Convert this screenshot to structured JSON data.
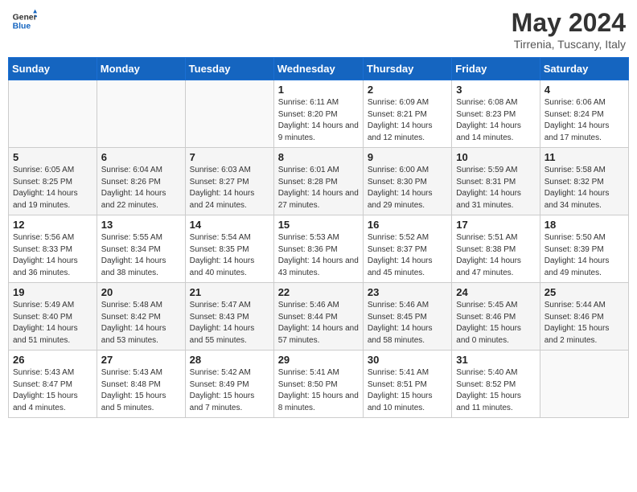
{
  "header": {
    "logo_line1": "General",
    "logo_line2": "Blue",
    "month": "May 2024",
    "location": "Tirrenia, Tuscany, Italy"
  },
  "columns": [
    "Sunday",
    "Monday",
    "Tuesday",
    "Wednesday",
    "Thursday",
    "Friday",
    "Saturday"
  ],
  "weeks": [
    [
      {
        "day": "",
        "info": ""
      },
      {
        "day": "",
        "info": ""
      },
      {
        "day": "",
        "info": ""
      },
      {
        "day": "1",
        "info": "Sunrise: 6:11 AM\nSunset: 8:20 PM\nDaylight: 14 hours and 9 minutes."
      },
      {
        "day": "2",
        "info": "Sunrise: 6:09 AM\nSunset: 8:21 PM\nDaylight: 14 hours and 12 minutes."
      },
      {
        "day": "3",
        "info": "Sunrise: 6:08 AM\nSunset: 8:23 PM\nDaylight: 14 hours and 14 minutes."
      },
      {
        "day": "4",
        "info": "Sunrise: 6:06 AM\nSunset: 8:24 PM\nDaylight: 14 hours and 17 minutes."
      }
    ],
    [
      {
        "day": "5",
        "info": "Sunrise: 6:05 AM\nSunset: 8:25 PM\nDaylight: 14 hours and 19 minutes."
      },
      {
        "day": "6",
        "info": "Sunrise: 6:04 AM\nSunset: 8:26 PM\nDaylight: 14 hours and 22 minutes."
      },
      {
        "day": "7",
        "info": "Sunrise: 6:03 AM\nSunset: 8:27 PM\nDaylight: 14 hours and 24 minutes."
      },
      {
        "day": "8",
        "info": "Sunrise: 6:01 AM\nSunset: 8:28 PM\nDaylight: 14 hours and 27 minutes."
      },
      {
        "day": "9",
        "info": "Sunrise: 6:00 AM\nSunset: 8:30 PM\nDaylight: 14 hours and 29 minutes."
      },
      {
        "day": "10",
        "info": "Sunrise: 5:59 AM\nSunset: 8:31 PM\nDaylight: 14 hours and 31 minutes."
      },
      {
        "day": "11",
        "info": "Sunrise: 5:58 AM\nSunset: 8:32 PM\nDaylight: 14 hours and 34 minutes."
      }
    ],
    [
      {
        "day": "12",
        "info": "Sunrise: 5:56 AM\nSunset: 8:33 PM\nDaylight: 14 hours and 36 minutes."
      },
      {
        "day": "13",
        "info": "Sunrise: 5:55 AM\nSunset: 8:34 PM\nDaylight: 14 hours and 38 minutes."
      },
      {
        "day": "14",
        "info": "Sunrise: 5:54 AM\nSunset: 8:35 PM\nDaylight: 14 hours and 40 minutes."
      },
      {
        "day": "15",
        "info": "Sunrise: 5:53 AM\nSunset: 8:36 PM\nDaylight: 14 hours and 43 minutes."
      },
      {
        "day": "16",
        "info": "Sunrise: 5:52 AM\nSunset: 8:37 PM\nDaylight: 14 hours and 45 minutes."
      },
      {
        "day": "17",
        "info": "Sunrise: 5:51 AM\nSunset: 8:38 PM\nDaylight: 14 hours and 47 minutes."
      },
      {
        "day": "18",
        "info": "Sunrise: 5:50 AM\nSunset: 8:39 PM\nDaylight: 14 hours and 49 minutes."
      }
    ],
    [
      {
        "day": "19",
        "info": "Sunrise: 5:49 AM\nSunset: 8:40 PM\nDaylight: 14 hours and 51 minutes."
      },
      {
        "day": "20",
        "info": "Sunrise: 5:48 AM\nSunset: 8:42 PM\nDaylight: 14 hours and 53 minutes."
      },
      {
        "day": "21",
        "info": "Sunrise: 5:47 AM\nSunset: 8:43 PM\nDaylight: 14 hours and 55 minutes."
      },
      {
        "day": "22",
        "info": "Sunrise: 5:46 AM\nSunset: 8:44 PM\nDaylight: 14 hours and 57 minutes."
      },
      {
        "day": "23",
        "info": "Sunrise: 5:46 AM\nSunset: 8:45 PM\nDaylight: 14 hours and 58 minutes."
      },
      {
        "day": "24",
        "info": "Sunrise: 5:45 AM\nSunset: 8:46 PM\nDaylight: 15 hours and 0 minutes."
      },
      {
        "day": "25",
        "info": "Sunrise: 5:44 AM\nSunset: 8:46 PM\nDaylight: 15 hours and 2 minutes."
      }
    ],
    [
      {
        "day": "26",
        "info": "Sunrise: 5:43 AM\nSunset: 8:47 PM\nDaylight: 15 hours and 4 minutes."
      },
      {
        "day": "27",
        "info": "Sunrise: 5:43 AM\nSunset: 8:48 PM\nDaylight: 15 hours and 5 minutes."
      },
      {
        "day": "28",
        "info": "Sunrise: 5:42 AM\nSunset: 8:49 PM\nDaylight: 15 hours and 7 minutes."
      },
      {
        "day": "29",
        "info": "Sunrise: 5:41 AM\nSunset: 8:50 PM\nDaylight: 15 hours and 8 minutes."
      },
      {
        "day": "30",
        "info": "Sunrise: 5:41 AM\nSunset: 8:51 PM\nDaylight: 15 hours and 10 minutes."
      },
      {
        "day": "31",
        "info": "Sunrise: 5:40 AM\nSunset: 8:52 PM\nDaylight: 15 hours and 11 minutes."
      },
      {
        "day": "",
        "info": ""
      }
    ]
  ]
}
